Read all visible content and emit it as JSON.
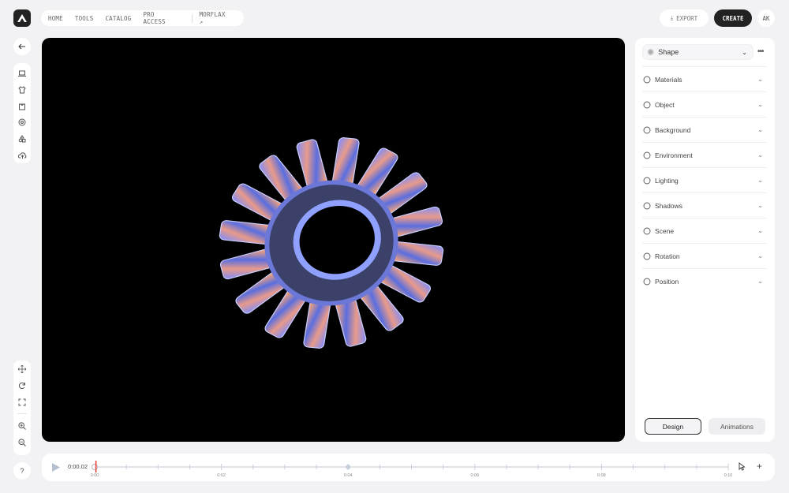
{
  "nav": {
    "items": [
      "HOME",
      "TOOLS",
      "CATALOG",
      "PRO ACCESS"
    ],
    "external": "MORFLAX ↗"
  },
  "header": {
    "export": "EXPORT",
    "create": "CREATE",
    "avatar": "AK"
  },
  "panel": {
    "shape_label": "Shape",
    "sections": [
      "Materials",
      "Object",
      "Background",
      "Environment",
      "Lighting",
      "Shadows",
      "Scene",
      "Rotation",
      "Position"
    ],
    "tabs": [
      "Design",
      "Animations"
    ]
  },
  "timeline": {
    "current_time": "0:00.02",
    "tick_labels": [
      "0:00",
      "0:02",
      "0:04",
      "0:06",
      "0:08",
      "0:10"
    ],
    "playhead_fraction": 0.002,
    "keyframe_time": "0:04"
  },
  "help": "?",
  "colors": {
    "accent": "#222222",
    "playhead": "#e53935",
    "background": "#f2f2f4"
  }
}
